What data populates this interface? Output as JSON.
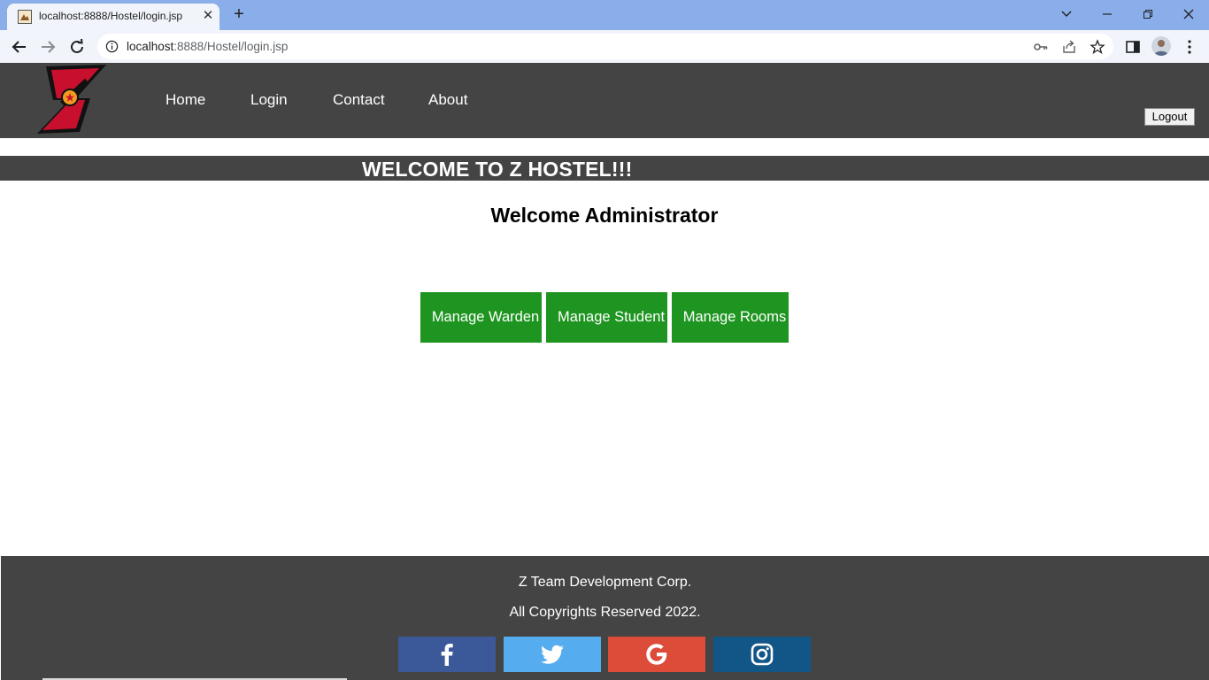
{
  "browser": {
    "tab_title": "localhost:8888/Hostel/login.jsp",
    "url_host": "localhost",
    "url_rest": ":8888/Hostel/login.jsp"
  },
  "site": {
    "menu": [
      {
        "label": "Home"
      },
      {
        "label": "Login"
      },
      {
        "label": "Contact"
      },
      {
        "label": "About"
      }
    ],
    "logout_label": "Logout",
    "banner": "WELCOME TO Z HOSTEL!!!",
    "heading": "Welcome Administrator",
    "actions": [
      {
        "label": "Manage Warden"
      },
      {
        "label": "Manage Student"
      },
      {
        "label": "Manage Rooms"
      }
    ]
  },
  "footer": {
    "company": "Z Team Development Corp.",
    "copyright": "All Copyrights Reserved 2022.",
    "social": [
      {
        "name": "facebook",
        "color": "#3b5998"
      },
      {
        "name": "twitter",
        "color": "#55acee"
      },
      {
        "name": "google",
        "color": "#dd4b39"
      },
      {
        "name": "instagram",
        "color": "#125688"
      }
    ]
  }
}
